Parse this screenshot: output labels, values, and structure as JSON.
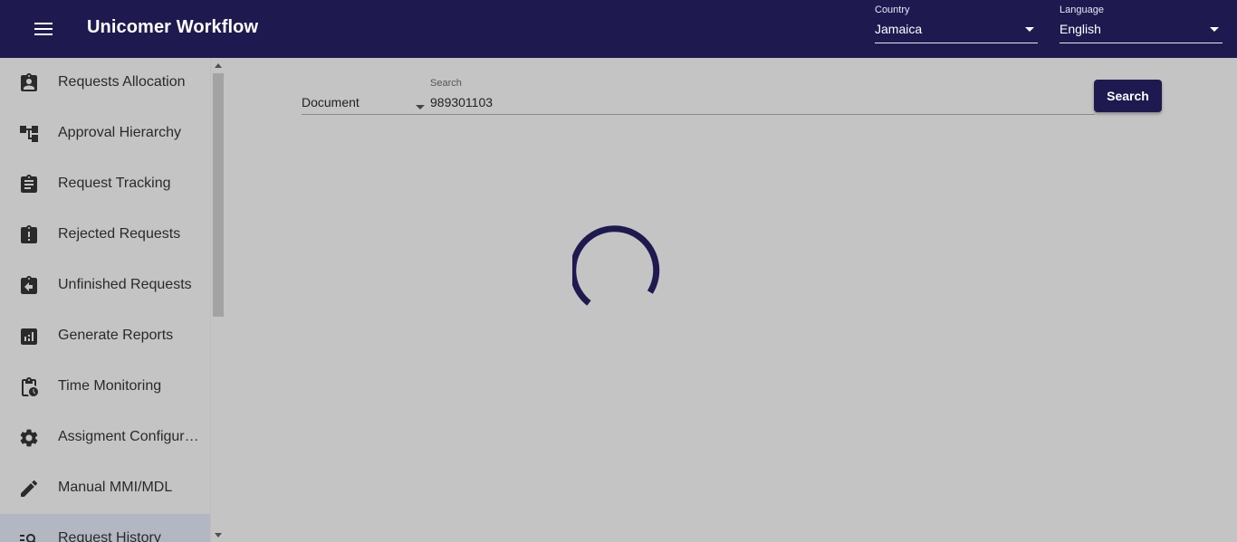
{
  "app": {
    "title": "Unicomer Workflow"
  },
  "header": {
    "menu_icon": "hamburger-menu-icon",
    "country": {
      "label": "Country",
      "value": "Jamaica"
    },
    "language": {
      "label": "Language",
      "value": "English"
    }
  },
  "sidebar": {
    "items": [
      {
        "label": "Requests Allocation",
        "icon": "assignment-ind-icon"
      },
      {
        "label": "Approval Hierarchy",
        "icon": "account-tree-icon"
      },
      {
        "label": "Request Tracking",
        "icon": "assignment-icon"
      },
      {
        "label": "Rejected Requests",
        "icon": "assignment-late-icon"
      },
      {
        "label": "Unfinished Requests",
        "icon": "assignment-return-icon"
      },
      {
        "label": "Generate Reports",
        "icon": "assessment-icon"
      },
      {
        "label": "Time Monitoring",
        "icon": "pending-actions-icon"
      },
      {
        "label": "Assigment Configuration",
        "icon": "settings-icon"
      },
      {
        "label": "Manual MMI/MDL",
        "icon": "edit-pencil-icon"
      },
      {
        "label": "Request History",
        "icon": "manage-search-icon",
        "active": true
      }
    ]
  },
  "search": {
    "type_value": "Document",
    "label": "Search",
    "value": "989301103",
    "button_label": "Search"
  },
  "colors": {
    "primary": "#1e1a4f",
    "background": "#c4c4c4",
    "active_item": "#b3b7c2"
  },
  "status": {
    "loading_icon": "circular-progress-spinner"
  }
}
